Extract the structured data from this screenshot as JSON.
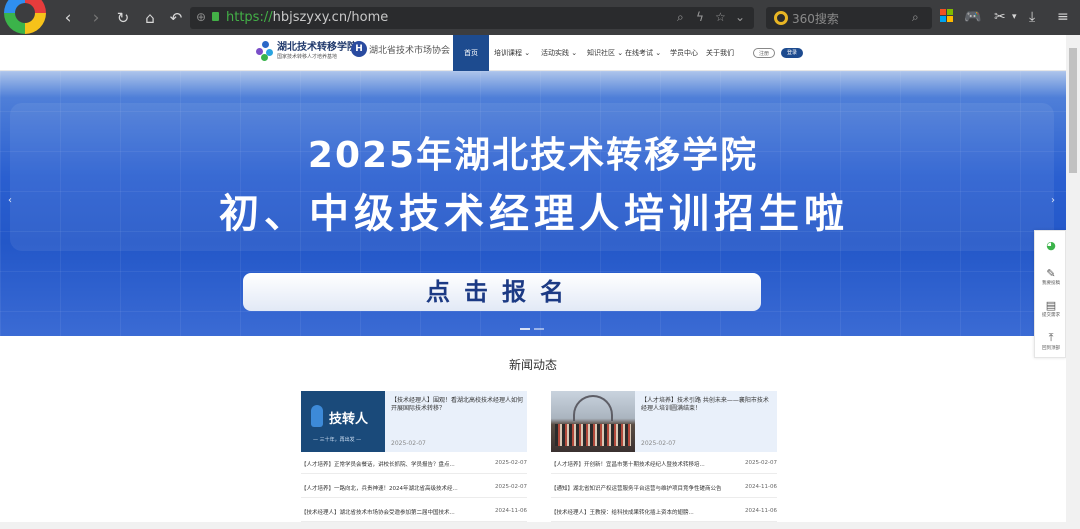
{
  "browser": {
    "url_scheme": "https://",
    "url_rest": "hbjszyxy.cn/home",
    "search_placeholder": "360搜索"
  },
  "site": {
    "brand_title": "湖北技术转移学院",
    "brand_subtitle": "国家技术转移人才培养基地",
    "assoc_logo": "H",
    "assoc_name": "湖北省技术市场协会",
    "nav": {
      "home": "首页",
      "training": "培训课程",
      "activities": "活动实践",
      "community": "知识社区",
      "exam": "在线考试",
      "member": "学员中心",
      "about": "关于我们"
    },
    "register": "注册",
    "login": "登录"
  },
  "banner": {
    "line1": "2025年湖北技术转移学院",
    "line2": "初、中级技术经理人培训招生啦",
    "cta": "点击报名",
    "prev": "‹",
    "next": "›"
  },
  "news": {
    "title": "新闻动态",
    "left": {
      "card_title": "【技术经理人】围观！看湖北高校技术经理人如何开展国际技术转移？",
      "card_date": "2025-02-07",
      "thumb_text": "技转人",
      "thumb_tag": "— 三十年，再出发 —",
      "rows": [
        {
          "title": "【人才培养】正常学员会餐话，讲校长抓院、学员报告？盘点...",
          "date": "2025-02-07"
        },
        {
          "title": "【人才培养】一路向北，兵贵神速！2024年湖北省高级技术经...",
          "date": "2025-02-07"
        },
        {
          "title": "【技术经理人】湖北省技术市场协会受邀参加第二届中国技术...",
          "date": "2024-11-06"
        }
      ]
    },
    "right": {
      "card_title": "【人才培养】技术引路 共创未来——襄阳市技术经理人培训圆满结束！",
      "card_date": "2025-02-07",
      "rows": [
        {
          "title": "【人才培养】开创新！宜昌市第十期技术经纪人暨技术转移培...",
          "date": "2025-02-07"
        },
        {
          "title": "【通知】湖北省知识产权运营服务平台运营与维护项目竞争性磋商公告！",
          "date": "2024-11-06"
        },
        {
          "title": "【技术经理人】王教授：给科技成果转化插上资本的翅膀...",
          "date": "2024-11-06"
        }
      ]
    }
  },
  "float_bar": {
    "wechat": "",
    "feedback": "我要投稿",
    "submit": "提交需求",
    "top": "回到顶部"
  }
}
